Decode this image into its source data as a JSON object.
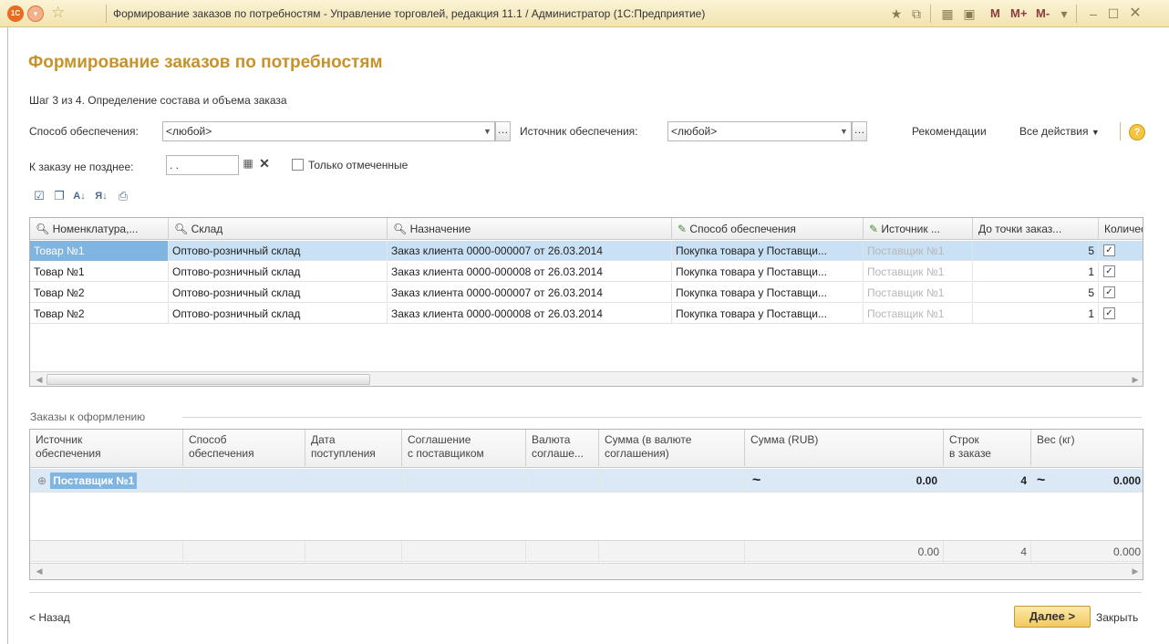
{
  "window": {
    "logo": "1C",
    "title": "Формирование заказов по потребностям - Управление торговлей, редакция 11.1 / Администратор  (1С:Предприятие)",
    "m_buttons": [
      "M",
      "M+",
      "M-"
    ]
  },
  "page": {
    "title": "Формирование заказов по потребностям",
    "step": "Шаг 3 из 4. Определение состава и объема заказа"
  },
  "filters": {
    "supply_method_label": "Способ обеспечения:",
    "supply_method_value": "<любой>",
    "supply_source_label": "Источник обеспечения:",
    "supply_source_value": "<любой>",
    "deadline_label": "К заказу не позднее:",
    "deadline_value": " .  .",
    "only_marked_label": "Только отмеченные",
    "recommendations": "Рекомендации",
    "all_actions": "Все действия",
    "help": "?"
  },
  "needs_table": {
    "columns": [
      "Номенклатура,...",
      "Склад",
      "Назначение",
      "Способ обеспечения",
      "Источник ...",
      "До точки заказ...",
      "Количес"
    ],
    "rows": [
      {
        "item": "Товар №1",
        "warehouse": "Оптово-розничный склад",
        "purpose": "Заказ клиента 0000-000007 от 26.03.2014",
        "method": "Покупка товара у Поставщи...",
        "source": "Поставщик №1",
        "to_order_point": "5",
        "checked": true
      },
      {
        "item": "Товар №1",
        "warehouse": "Оптово-розничный склад",
        "purpose": "Заказ клиента 0000-000008 от 26.03.2014",
        "method": "Покупка товара у Поставщи...",
        "source": "Поставщик №1",
        "to_order_point": "1",
        "checked": true
      },
      {
        "item": "Товар №2",
        "warehouse": "Оптово-розничный склад",
        "purpose": "Заказ клиента 0000-000007 от 26.03.2014",
        "method": "Покупка товара у Поставщи...",
        "source": "Поставщик №1",
        "to_order_point": "5",
        "checked": true
      },
      {
        "item": "Товар №2",
        "warehouse": "Оптово-розничный склад",
        "purpose": "Заказ клиента 0000-000008 от 26.03.2014",
        "method": "Покупка товара у Поставщи...",
        "source": "Поставщик №1",
        "to_order_point": "1",
        "checked": true
      }
    ]
  },
  "orders": {
    "section_title": "Заказы к оформлению",
    "columns": [
      "Источник\nобеспечения",
      "Способ\nобеспечения",
      "Дата\nпоступления",
      "Соглашение\nс поставщиком",
      "Валюта\nсоглаше...",
      "Сумма (в валюте\nсоглашения)",
      "Сумма (RUB)",
      "Строк\nв заказе",
      "Вес (кг)"
    ],
    "row": {
      "supplier": "Поставщик №1",
      "sum_rub": "0.00",
      "lines": "4",
      "weight": "0.000",
      "approx": "~"
    },
    "totals": {
      "sum_rub": "0.00",
      "lines": "4",
      "weight": "0.000"
    }
  },
  "footer": {
    "back": "< Назад",
    "next": "Далее >",
    "close": "Закрыть"
  }
}
